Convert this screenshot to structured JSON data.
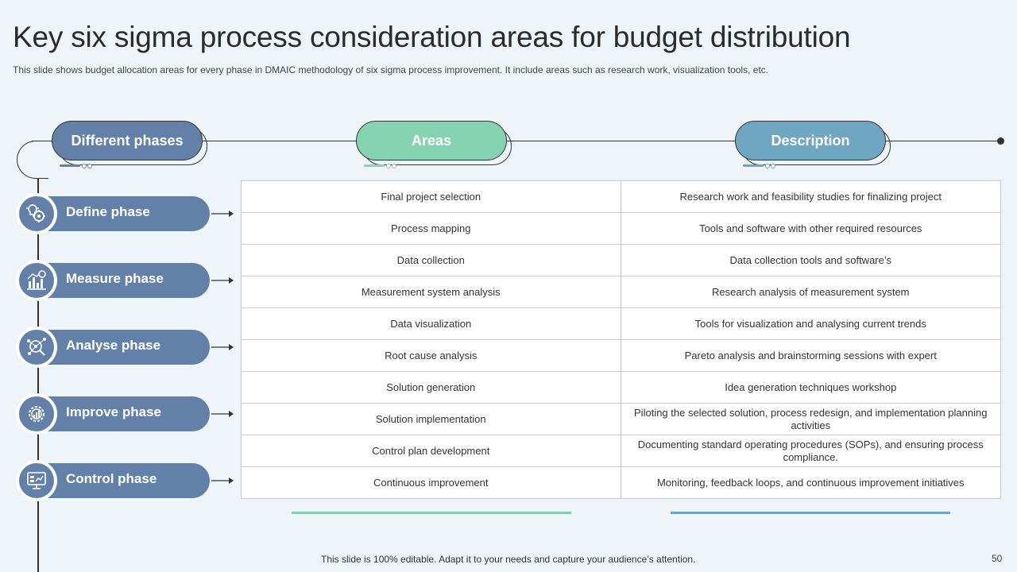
{
  "title": "Key six sigma process consideration areas for budget distribution",
  "subtitle": "This slide shows budget allocation areas for every phase in DMAIC methodology of six sigma process improvement. It include areas such as research work, visualization tools, etc.",
  "headers": {
    "phases": "Different phases",
    "areas": "Areas",
    "description": "Description"
  },
  "colors": {
    "phases": "#6381a8",
    "areas": "#86d3b2",
    "description": "#6fa6c2",
    "background": "#eef4f7"
  },
  "phases": [
    {
      "label": "Define phase",
      "icon": "gear-lightbulb-icon"
    },
    {
      "label": "Measure phase",
      "icon": "bar-chart-icon"
    },
    {
      "label": "Analyse phase",
      "icon": "network-analysis-icon"
    },
    {
      "label": "Improve phase",
      "icon": "gear-growth-icon"
    },
    {
      "label": "Control phase",
      "icon": "monitor-dashboard-icon"
    }
  ],
  "rows": [
    {
      "area": "Final project selection",
      "description": "Research work and feasibility studies for finalizing project"
    },
    {
      "area": "Process mapping",
      "description": "Tools and software with other required resources"
    },
    {
      "area": "Data collection",
      "description": "Data collection tools and software’s"
    },
    {
      "area": "Measurement system analysis",
      "description": "Research analysis of measurement system"
    },
    {
      "area": "Data visualization",
      "description": "Tools for visualization and analysing current trends"
    },
    {
      "area": "Root cause analysis",
      "description": "Pareto analysis and brainstorming sessions with expert"
    },
    {
      "area": "Solution generation",
      "description": "Idea generation techniques workshop"
    },
    {
      "area": "Solution implementation",
      "description": "Piloting the selected solution, process redesign, and implementation planning activities"
    },
    {
      "area": "Control plan development",
      "description": "Documenting standard operating procedures (SOPs), and ensuring process compliance."
    },
    {
      "area": "Continuous improvement",
      "description": "Monitoring, feedback loops, and continuous improvement initiatives"
    }
  ],
  "footer": "This slide is 100% editable. Adapt it to your needs and capture your audience’s attention.",
  "page_number": "50"
}
